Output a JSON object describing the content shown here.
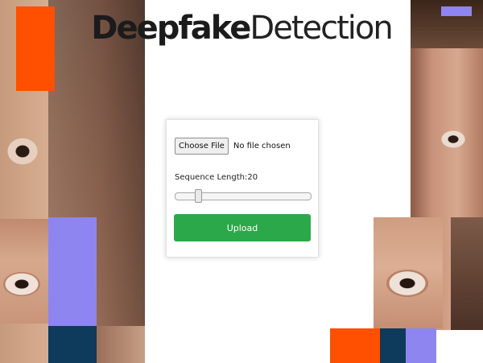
{
  "header": {
    "title_bold": "Deepfake",
    "title_light": "Detection"
  },
  "form": {
    "choose_file_label": "Choose File",
    "file_status": "No file chosen",
    "sequence_label": "Sequence Length:",
    "sequence_value": "20",
    "slider_fraction": 0.16,
    "upload_label": "Upload"
  },
  "colors": {
    "orange": "#ff4f00",
    "lavender": "#8e85f0",
    "navy": "#0e3a5b",
    "upload_green": "#2aa84a"
  }
}
